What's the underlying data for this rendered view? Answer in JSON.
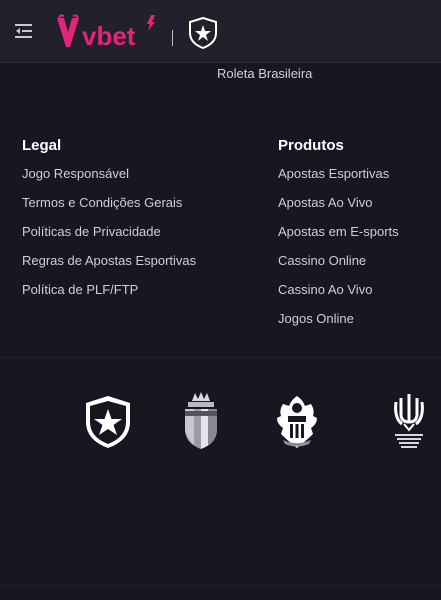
{
  "header": {
    "menu_icon": "menu-collapse-icon",
    "brand": "vbet",
    "club_icon": "botafogo-star-icon"
  },
  "top_link": "Roleta Brasileira",
  "legal": {
    "title": "Legal",
    "links": [
      "Jogo Responsável",
      "Termos e Condições Gerais",
      "Políticas de Privacidade",
      "Regras de Apostas Esportivas",
      "Política de PLF/FTP"
    ]
  },
  "products": {
    "title": "Produtos",
    "links": [
      "Apostas Esportivas",
      "Apostas Ao Vivo",
      "Apostas em E-sports",
      "Cassino Online",
      "Cassino Ao Vivo",
      "Jogos Online"
    ]
  },
  "partners": [
    "botafogo-crest-icon",
    "as-monaco-crest-icon",
    "ogc-nice-crest-icon",
    "ukrainian-football-association-crest-icon"
  ],
  "colors": {
    "brand_pink": "#e3247a",
    "background": "#181621",
    "header": "#22202b"
  }
}
